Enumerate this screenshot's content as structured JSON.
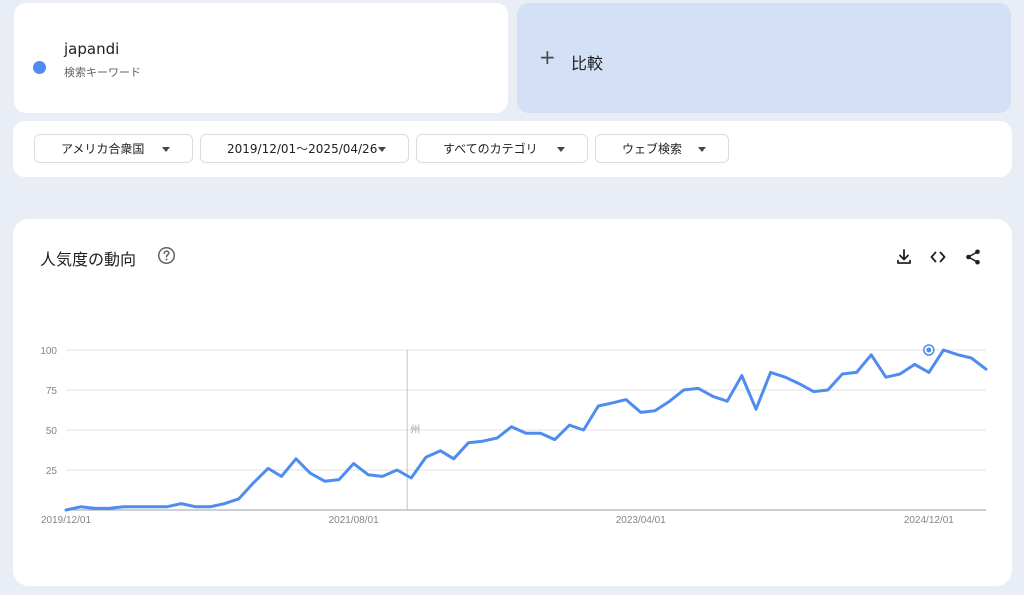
{
  "term": {
    "name": "japandi",
    "subtitle": "検索キーワード",
    "color": "#4f8cf0"
  },
  "compare": {
    "plus": "+",
    "label": "比較"
  },
  "filters": [
    {
      "label": "アメリカ合衆国"
    },
    {
      "label": "2019/12/01〜2025/04/26"
    },
    {
      "label": "すべてのカテゴリ"
    },
    {
      "label": "ウェブ検索"
    }
  ],
  "chart": {
    "title": "人気度の動向",
    "icons": [
      "help-icon",
      "download-icon",
      "embed-icon",
      "share-icon"
    ]
  },
  "chart_data": {
    "type": "line",
    "ylim": [
      0,
      100
    ],
    "yticks": [
      "100",
      "75",
      "50",
      "25"
    ],
    "xticks": [
      "2019/12/01",
      "2021/08/01",
      "2023/04/01",
      "2024/12/01"
    ],
    "annotation": "州",
    "grid": true,
    "series": [
      {
        "color": "#4f8cf0",
        "x": [
          "2019/12/01",
          "2020/01/01",
          "2020/02/01",
          "2020/03/01",
          "2020/04/01",
          "2020/05/01",
          "2020/06/01",
          "2020/07/01",
          "2020/08/01",
          "2020/09/01",
          "2020/10/01",
          "2020/11/01",
          "2020/12/01",
          "2021/01/01",
          "2021/02/01",
          "2021/03/01",
          "2021/04/01",
          "2021/05/01",
          "2021/06/01",
          "2021/07/01",
          "2021/08/01",
          "2021/09/01",
          "2021/10/01",
          "2021/11/01",
          "2021/12/01",
          "2022/01/01",
          "2022/02/01",
          "2022/03/01",
          "2022/04/01",
          "2022/05/01",
          "2022/06/01",
          "2022/07/01",
          "2022/08/01",
          "2022/09/01",
          "2022/10/01",
          "2022/11/01",
          "2022/12/01",
          "2023/01/01",
          "2023/02/01",
          "2023/03/01",
          "2023/04/01",
          "2023/05/01",
          "2023/06/01",
          "2023/07/01",
          "2023/08/01",
          "2023/09/01",
          "2023/10/01",
          "2023/11/01",
          "2023/12/01",
          "2024/01/01",
          "2024/02/01",
          "2024/03/01",
          "2024/04/01",
          "2024/05/01",
          "2024/06/01",
          "2024/07/01",
          "2024/08/01",
          "2024/09/01",
          "2024/10/01",
          "2024/11/01",
          "2024/12/01",
          "2025/01/01",
          "2025/02/01",
          "2025/03/01",
          "2025/04/01"
        ],
        "values": [
          0,
          2,
          1,
          1,
          2,
          2,
          2,
          2,
          4,
          2,
          2,
          4,
          7,
          17,
          26,
          21,
          32,
          23,
          18,
          19,
          29,
          22,
          21,
          25,
          20,
          33,
          37,
          32,
          42,
          43,
          45,
          52,
          48,
          48,
          44,
          53,
          50,
          65,
          67,
          69,
          61,
          62,
          68,
          75,
          76,
          71,
          68,
          84,
          63,
          86,
          83,
          79,
          74,
          75,
          85,
          86,
          97,
          83,
          85,
          91,
          86,
          100,
          97,
          95,
          88
        ]
      }
    ],
    "highlight": {
      "x": "2024/12/01",
      "y": 100
    }
  }
}
